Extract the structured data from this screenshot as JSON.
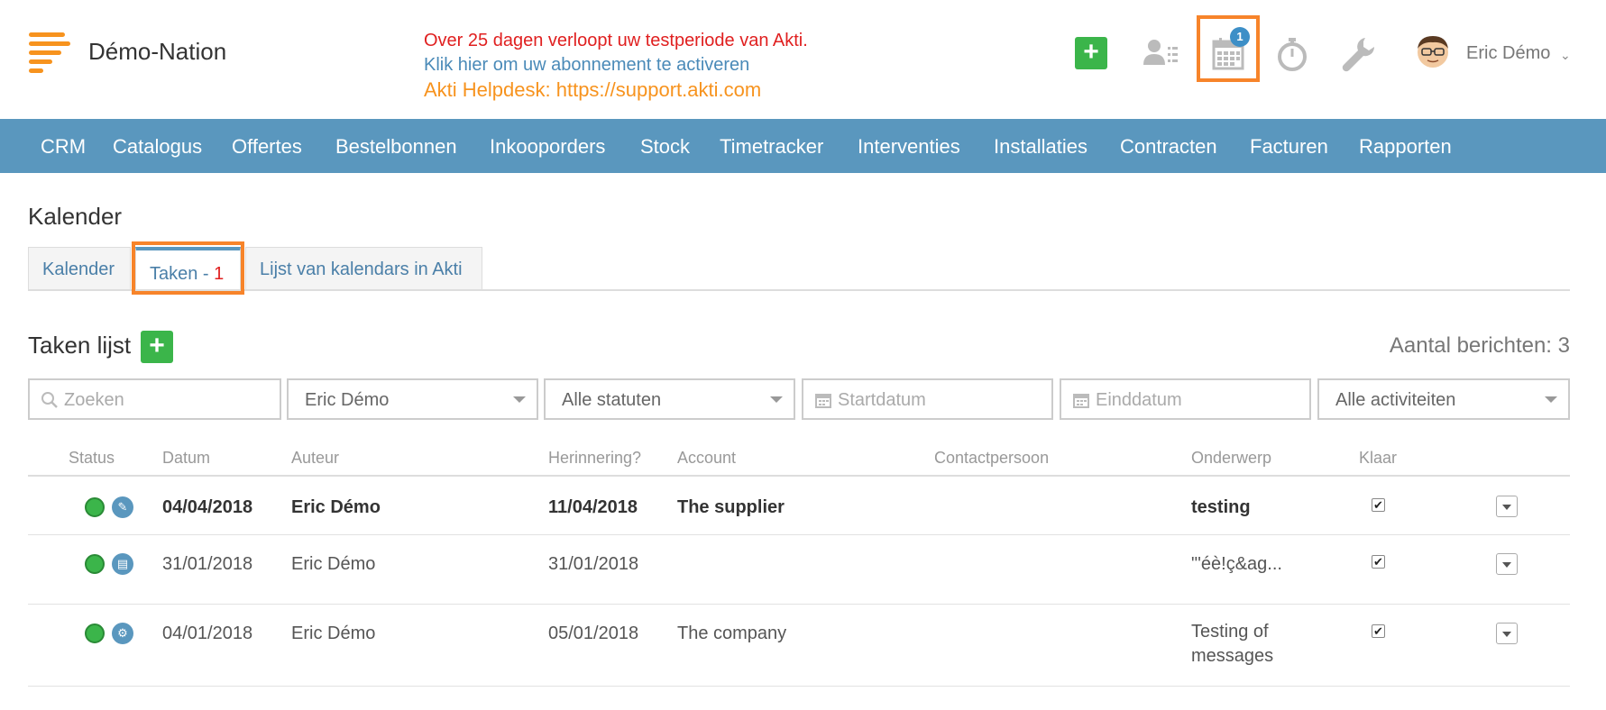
{
  "header": {
    "brand": "Démo-Nation",
    "notice_line1": "Over 25 dagen verloopt uw testperiode van Akti.",
    "notice_line2": "Klik hier om uw abonnement te activeren",
    "notice_line3": "Akti Helpdesk: https://support.akti.com",
    "calendar_badge": "1",
    "user_name": "Eric Démo",
    "add_label": "+"
  },
  "nav": [
    "CRM",
    "Catalogus",
    "Offertes",
    "Bestelbonnen",
    "Inkooporders",
    "Stock",
    "Timetracker",
    "Interventies",
    "Installaties",
    "Contracten",
    "Facturen",
    "Rapporten"
  ],
  "page": {
    "title": "Kalender",
    "tabs": [
      {
        "label": "Kalender"
      },
      {
        "label": "Taken - ",
        "count": "1"
      },
      {
        "label": "Lijst van kalendars in Akti"
      }
    ],
    "section_title": "Taken lijst",
    "count_text": "Aantal berichten: 3",
    "add_label": "+"
  },
  "filters": {
    "search_placeholder": "Zoeken",
    "user": "Eric Démo",
    "status": "Alle statuten",
    "start_placeholder": "Startdatum",
    "end_placeholder": "Einddatum",
    "activities": "Alle activiteiten"
  },
  "table": {
    "headers": [
      "Status",
      "Datum",
      "Auteur",
      "Herinnering?",
      "Account",
      "Contactpersoon",
      "Onderwerp",
      "Klaar"
    ],
    "rows": [
      {
        "date": "04/04/2018",
        "author": "Eric Démo",
        "reminder": "11/04/2018",
        "account": "The supplier",
        "contact": "",
        "subject": "testing",
        "done": true,
        "type_icon": "pen-icon"
      },
      {
        "date": "31/01/2018",
        "author": "Eric Démo",
        "reminder": "31/01/2018",
        "account": "",
        "contact": "",
        "subject": "\"'éè!ç&ag...",
        "done": true,
        "type_icon": "clipboard-icon"
      },
      {
        "date": "04/01/2018",
        "author": "Eric Démo",
        "reminder": "05/01/2018",
        "account": "The company",
        "contact": "",
        "subject": "Testing of messages",
        "done": true,
        "type_icon": "wrench-icon"
      }
    ]
  },
  "colors": {
    "accent": "#5a97be",
    "orange": "#f7931e",
    "green": "#3bb54a",
    "highlight": "#f7842a"
  }
}
